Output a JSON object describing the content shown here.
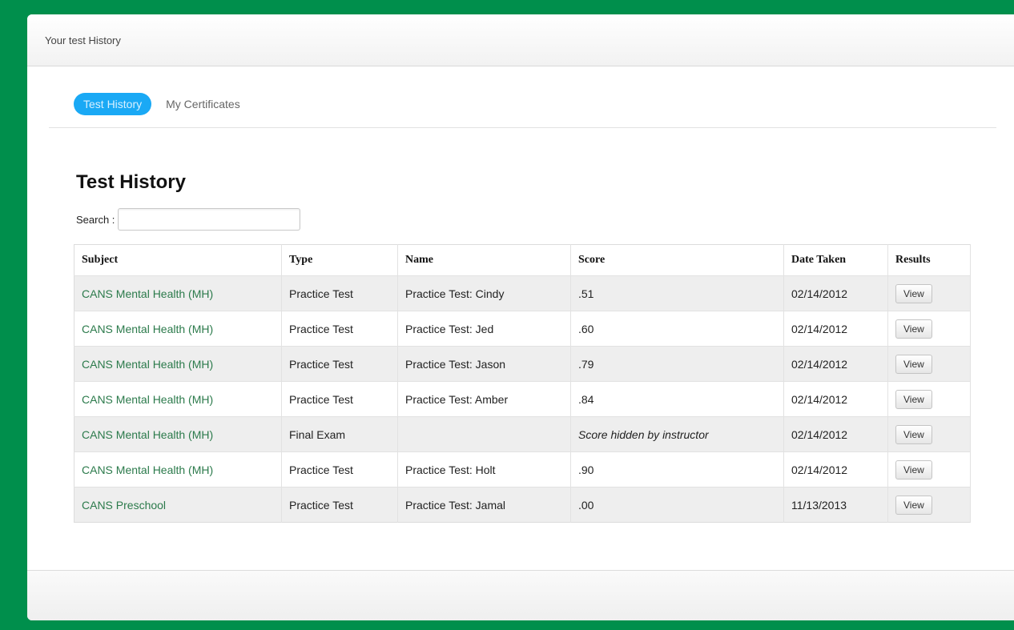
{
  "header": {
    "title": "Your test History"
  },
  "tabs": [
    {
      "label": "Test History",
      "active": true
    },
    {
      "label": "My Certificates",
      "active": false
    }
  ],
  "page": {
    "title": "Test History",
    "search_label": "Search :",
    "search_value": ""
  },
  "table": {
    "columns": [
      "Subject",
      "Type",
      "Name",
      "Score",
      "Date Taken",
      "Results"
    ],
    "rows": [
      {
        "subject": "CANS Mental Health (MH)",
        "type": "Practice Test",
        "name": "Practice Test: Cindy",
        "score": ".51",
        "date": "02/14/2012",
        "action": "View"
      },
      {
        "subject": "CANS Mental Health (MH)",
        "type": "Practice Test",
        "name": "Practice Test: Jed",
        "score": ".60",
        "date": "02/14/2012",
        "action": "View"
      },
      {
        "subject": "CANS Mental Health (MH)",
        "type": "Practice Test",
        "name": "Practice Test: Jason",
        "score": ".79",
        "date": "02/14/2012",
        "action": "View"
      },
      {
        "subject": "CANS Mental Health (MH)",
        "type": "Practice Test",
        "name": "Practice Test: Amber",
        "score": ".84",
        "date": "02/14/2012",
        "action": "View"
      },
      {
        "subject": "CANS Mental Health (MH)",
        "type": "Final Exam",
        "name": "",
        "score": "Score hidden by instructor",
        "date": "02/14/2012",
        "action": "View"
      },
      {
        "subject": "CANS Mental Health (MH)",
        "type": "Practice Test",
        "name": "Practice Test: Holt",
        "score": ".90",
        "date": "02/14/2012",
        "action": "View"
      },
      {
        "subject": "CANS Preschool",
        "type": "Practice Test",
        "name": "Practice Test: Jamal",
        "score": ".00",
        "date": "11/13/2013",
        "action": "View"
      }
    ]
  },
  "colors": {
    "background": "#008f4c",
    "active_tab": "#1aa9f5",
    "subject_link": "#2b7a4b"
  }
}
